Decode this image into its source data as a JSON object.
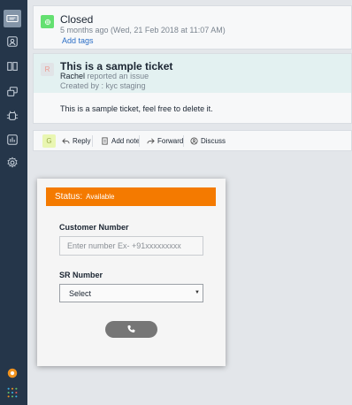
{
  "sidebar": {
    "icons": [
      "ticket-icon",
      "contact-icon",
      "book-icon",
      "chat-icon",
      "bug-icon",
      "report-icon",
      "gear-icon",
      "notification-icon",
      "apps-grid-icon"
    ],
    "active": "ticket-icon",
    "colors": {
      "background": "#25364a",
      "active": "#8495a8",
      "notification": "#f0921e"
    }
  },
  "status_update": {
    "title": "Closed",
    "time": "5 months ago (Wed, 21 Feb 2018 at 11:07 AM)",
    "add_tags": "Add tags",
    "status_color": "#64e071"
  },
  "ticket": {
    "avatar_initial": "R",
    "title": "This is a sample ticket",
    "requester": "Rachel",
    "action": "reported an issue",
    "created_by": "Created by : kyc staging",
    "body": "This is a sample ticket, feel free to delete it."
  },
  "toolbar": {
    "avatar_initial": "G",
    "reply": "Reply",
    "add_note": "Add note",
    "forward": "Forward",
    "discuss": "Discuss"
  },
  "dialer": {
    "status_label": "Status:",
    "status_value": "Available",
    "status_color": "#f47a00",
    "customer_number_label": "Customer Number",
    "customer_number_placeholder": "Enter number Ex- +91xxxxxxxxx",
    "customer_number_value": "",
    "sr_number_label": "SR Number",
    "sr_number_selected": "Select",
    "call_icon": "phone-icon"
  }
}
